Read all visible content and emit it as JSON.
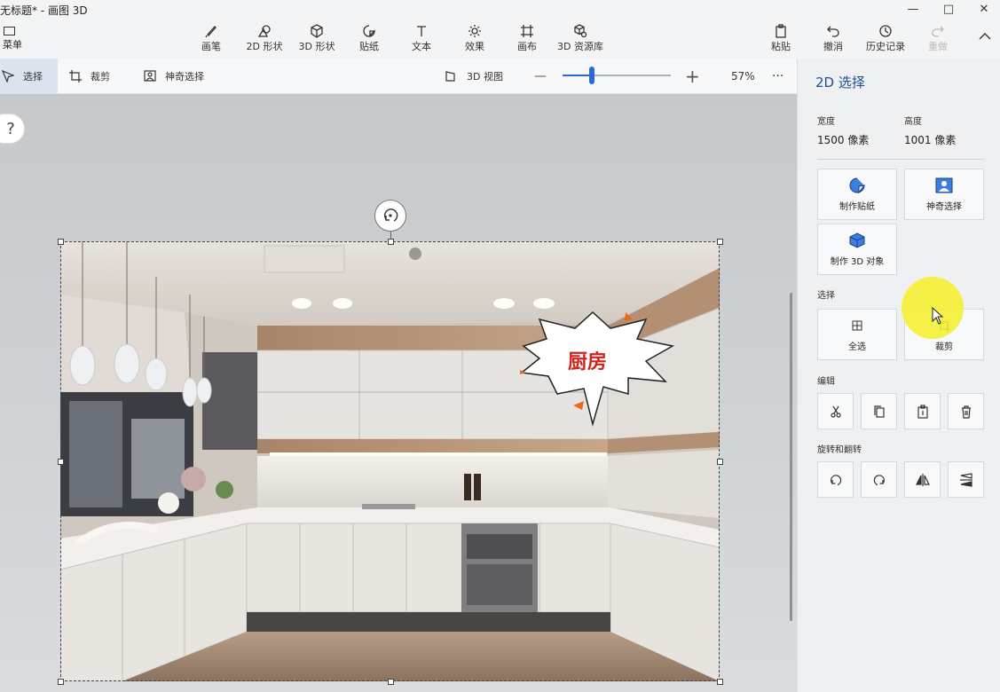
{
  "window": {
    "title": "无标题* - 画图 3D",
    "minimize": "—",
    "maximize": "□",
    "close": "✕"
  },
  "menu": {
    "label": "菜单"
  },
  "tools": [
    {
      "label": "画笔",
      "icon": "brush-icon"
    },
    {
      "label": "2D 形状",
      "icon": "2d-shapes-icon"
    },
    {
      "label": "3D 形状",
      "icon": "3d-shapes-icon"
    },
    {
      "label": "贴纸",
      "icon": "sticker-icon"
    },
    {
      "label": "文本",
      "icon": "text-icon"
    },
    {
      "label": "效果",
      "icon": "effects-icon"
    },
    {
      "label": "画布",
      "icon": "canvas-icon"
    },
    {
      "label": "3D 资源库",
      "icon": "3d-library-icon"
    }
  ],
  "actions": [
    {
      "label": "粘贴",
      "icon": "paste-icon"
    },
    {
      "label": "撤消",
      "icon": "undo-icon"
    },
    {
      "label": "历史记录",
      "icon": "history-icon"
    },
    {
      "label": "重做",
      "icon": "redo-icon"
    }
  ],
  "subbar": {
    "select": "选择",
    "crop": "裁剪",
    "magic_select": "神奇选择",
    "view3d": "3D 视图",
    "zoom_minus": "—",
    "zoom_plus": "+",
    "zoom_level": "57%",
    "zoom_fraction": 0.27,
    "more": "···"
  },
  "canvas": {
    "help": "?",
    "bubble_text": "厨房"
  },
  "panel": {
    "title": "2D 选择",
    "width_label": "宽度",
    "width_value": "1500 像素",
    "height_label": "高度",
    "height_value": "1001 像素",
    "make_sticker": "制作贴纸",
    "magic_select": "神奇选择",
    "make_3d": "制作 3D 对象",
    "select_section": "选择",
    "select_all": "全选",
    "crop": "裁剪",
    "edit_section": "编辑",
    "rotate_section": "旋转和翻转"
  },
  "colors": {
    "accent": "#2a6bd1",
    "bubble_text": "#d2231c",
    "highlight": "#f5f028"
  }
}
